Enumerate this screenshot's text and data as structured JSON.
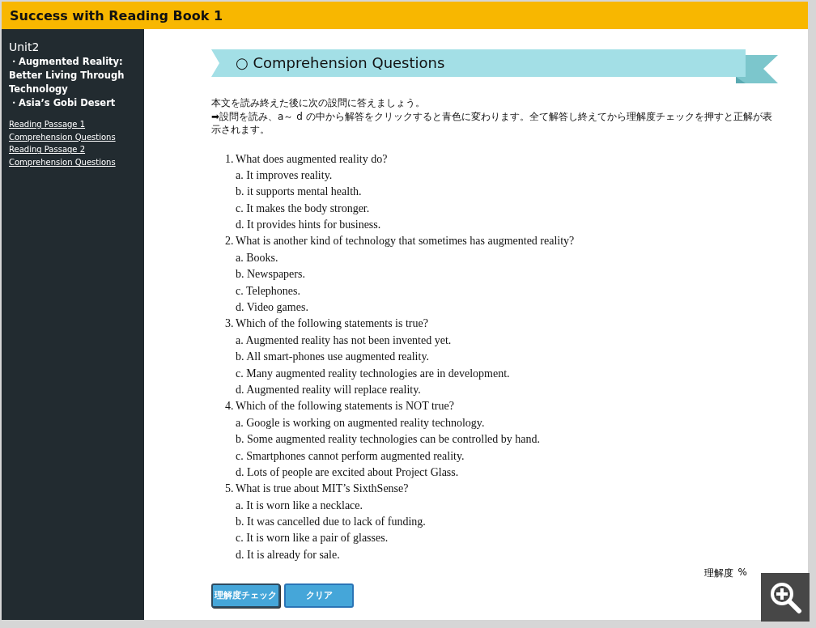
{
  "header": {
    "title": "Success with Reading Book 1"
  },
  "sidebar": {
    "unit": "Unit2",
    "topics": [
      "・Augmented Reality: Better Living Through Technology",
      "・Asia’s Gobi Desert"
    ],
    "links": [
      "Reading Passage 1",
      "Comprehension Questions",
      "Reading Passage 2",
      "Comprehension Questions"
    ]
  },
  "section": {
    "heading": "○ Comprehension Questions",
    "instructions": [
      "本文を読み終えた後に次の設問に答えましょう。",
      "➡設問を読み、a～ d の中から解答をクリックすると青色に変わります。全て解答し終えてから理解度チェックを押すと正解が表示されます。"
    ]
  },
  "questions": [
    {
      "number": "1.",
      "text": "What does augmented reality do?",
      "options": [
        "a. It improves reality.",
        "b. it supports mental health.",
        "c. It makes the body stronger.",
        "d. It provides hints for business."
      ]
    },
    {
      "number": "2.",
      "text": "What is another kind of technology that sometimes has augmented reality?",
      "options": [
        "a. Books.",
        "b. Newspapers.",
        "c. Telephones.",
        "d. Video games."
      ]
    },
    {
      "number": "3.",
      "text": "Which of the following statements is true?",
      "options": [
        "a. Augmented reality has not been invented yet.",
        "b. All smart-phones use augmented reality.",
        "c. Many augmented reality technologies are in development.",
        "d. Augmented reality will replace reality."
      ]
    },
    {
      "number": "4.",
      "text": "Which of the following statements is NOT true?",
      "options": [
        "a. Google is working on augmented reality technology.",
        "b. Some augmented reality technologies can be controlled by hand.",
        "c. Smartphones cannot perform augmented reality.",
        "d. Lots of people are excited about Project Glass."
      ]
    },
    {
      "number": "5.",
      "text": "What is true about MIT’s SixthSense?",
      "options": [
        "a. It is worn like a necklace.",
        "b. It was cancelled due to lack of funding.",
        "c. It is worn like a pair of glasses.",
        "d. It is already for sale."
      ]
    }
  ],
  "score": {
    "label": "理解度",
    "unit": "%"
  },
  "buttons": [
    "理解度チェック",
    "クリア"
  ]
}
